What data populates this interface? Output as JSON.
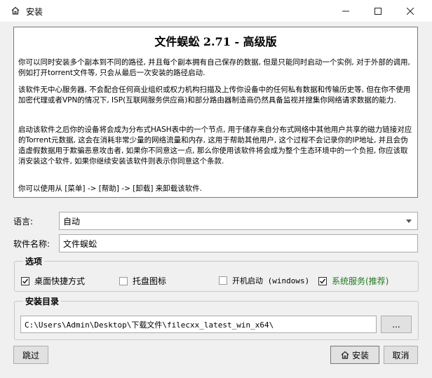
{
  "window": {
    "title": "安装",
    "icons": {
      "app": "home-icon",
      "minimize": "minimize-icon",
      "maximize": "maximize-icon",
      "close": "close-icon"
    }
  },
  "info": {
    "heading": "文件蜈蚣 2.71 - 高级版",
    "paragraphs": [
      "你可以同时安装多个副本到不同的路径, 并且每个副本拥有自己保存的数据, 但是只能同时启动一个实例, 对于外部的调用, 例如打开torrent文件等, 只会从最后一次安装的路径启动.",
      "该软件无中心服务器, 不会配合任何商业组织或权力机构扫描及上传你设备中的任何私有数据和传输历史等, 但在你不使用加密代理或者VPN的情况下, ISP(互联网服务供应商)和部分路由器制造商仍然具备监视并搜集你网络请求数据的能力.",
      "启动该软件之后你的设备将会成为分布式HASH表中的一个节点, 用于储存来自分布式网络中其他用户共享的磁力链接对应的Torrent元数据, 这会在消耗非常少量的网络流量和内存, 这用于帮助其他用户, 这个过程不会记录你的IP地址, 并且会伪造虚假数据用于欺骗恶意攻击者, 如果你不同意这一点, 那么你使用该软件将会成为整个生态环境中的一个负担, 你应该取消安装这个软件, 如果你继续安装该软件则表示你同意这个条款.",
      "你可以使用从 [菜单] -> [帮助] -> [卸载] 来卸载该软件."
    ]
  },
  "language": {
    "label": "语言:",
    "value": "自动"
  },
  "software_name": {
    "label": "软件名称:",
    "value": "文件蜈蚣"
  },
  "options": {
    "title": "选项",
    "items": [
      {
        "label": "桌面快捷方式",
        "checked": true
      },
      {
        "label": "托盘图标",
        "checked": false
      },
      {
        "label": "开机启动 (windows)",
        "checked": false
      },
      {
        "label": "系统服务(推荐)",
        "checked": true,
        "color": "#1f7a1f"
      }
    ]
  },
  "install_dir": {
    "title": "安装目录",
    "path": "C:\\Users\\Admin\\Desktop\\下载文件\\filecxx_latest_win_x64\\",
    "browse_label": "..."
  },
  "buttons": {
    "skip": "跳过",
    "install": "安装",
    "install_icon": "home-icon",
    "cancel": "取消"
  }
}
